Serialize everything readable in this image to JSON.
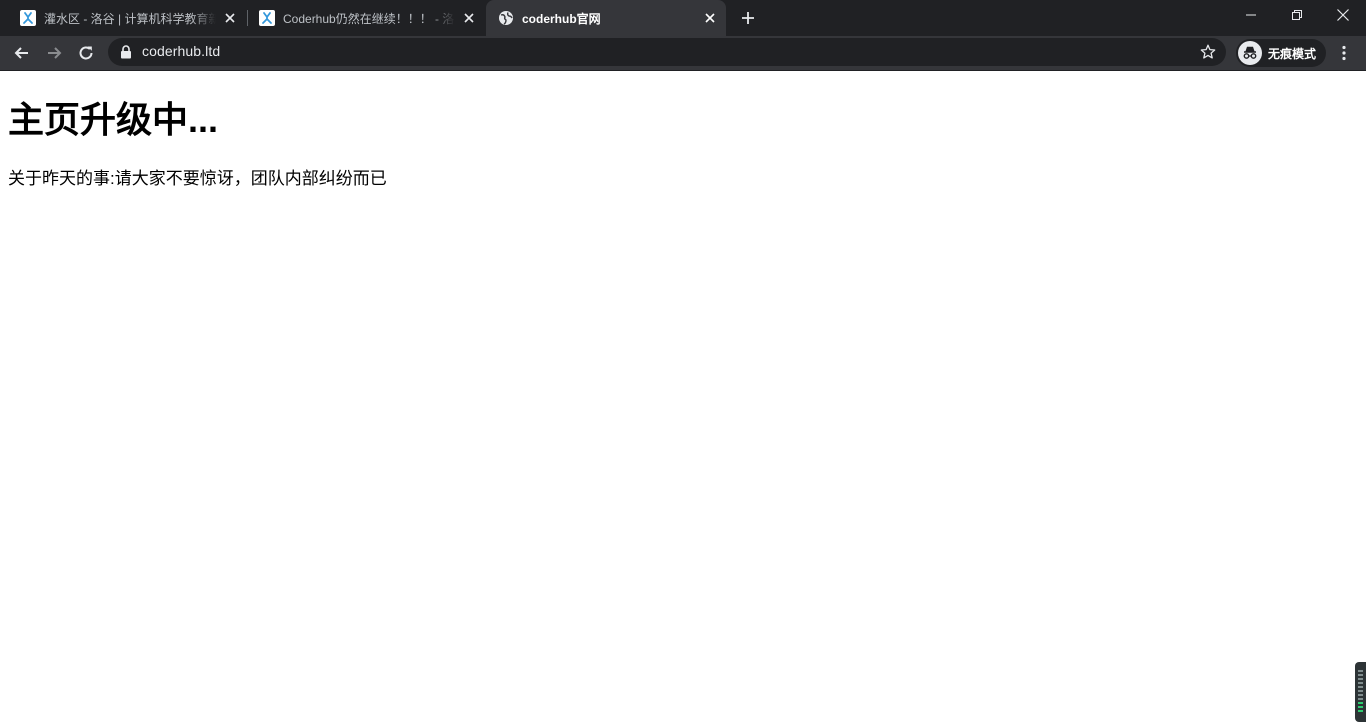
{
  "browser": {
    "tabs": [
      {
        "title": "灌水区 - 洛谷 | 计算机科学教育新",
        "favicon": "luogu-icon",
        "active": false
      },
      {
        "title": "Coderhub仍然在继续！！！ - 洛",
        "favicon": "luogu-icon",
        "active": false
      },
      {
        "title": "coderhub官网",
        "favicon": "globe-icon",
        "active": true
      }
    ],
    "address_bar": {
      "url": "coderhub.ltd",
      "secure": true
    },
    "incognito_label": "无痕模式",
    "theme": {
      "tabstrip_bg": "#202124",
      "toolbar_bg": "#35363a",
      "omnibox_bg": "#202124",
      "luogu_blue": "#3498db"
    }
  },
  "page": {
    "heading": "主页升级中...",
    "paragraph": "关于昨天的事:请大家不要惊讶，团队内部纠纷而已"
  }
}
